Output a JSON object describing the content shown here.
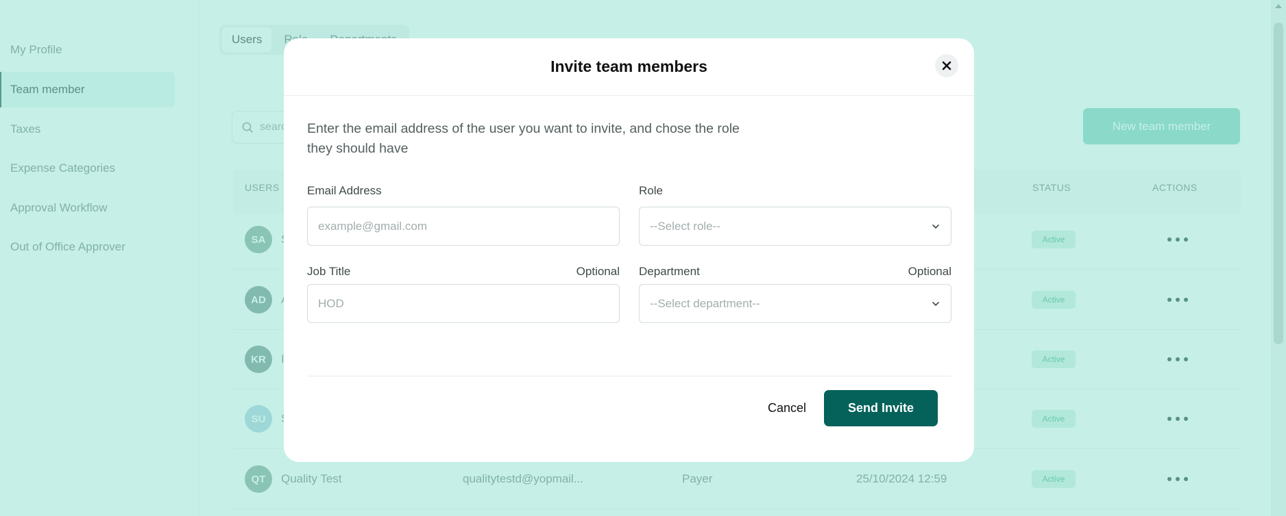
{
  "sidebar": {
    "items": [
      {
        "label": "My Profile"
      },
      {
        "label": "Team member"
      },
      {
        "label": "Taxes"
      },
      {
        "label": "Expense Categories"
      },
      {
        "label": "Approval Workflow"
      },
      {
        "label": "Out of Office Approver"
      }
    ]
  },
  "tabs": [
    {
      "label": "Users"
    },
    {
      "label": "Role"
    },
    {
      "label": "Departments"
    }
  ],
  "search": {
    "placeholder": "search"
  },
  "new_member_button": "New team member",
  "table": {
    "headers": {
      "users": "USERS",
      "status": "STATUS",
      "actions": "ACTIONS"
    },
    "rows": [
      {
        "initials": "SA",
        "name": "S",
        "email": "",
        "role": "",
        "date": "",
        "status": "Active",
        "avatar_color": "#8fae9f"
      },
      {
        "initials": "AD",
        "name": "A",
        "email": "",
        "role": "",
        "date": "",
        "status": "Active",
        "avatar_color": "#7f9c97"
      },
      {
        "initials": "KR",
        "name": "I",
        "email": "",
        "role": "",
        "date": "",
        "status": "Active",
        "avatar_color": "#7f9c97"
      },
      {
        "initials": "SU",
        "name": "S",
        "email": "",
        "role": "",
        "date": "",
        "status": "Active",
        "avatar_color": "#b3d2e0"
      },
      {
        "initials": "QT",
        "name": "Quality Test",
        "email": "qualitytestd@yopmail...",
        "role": "Payer",
        "date": "25/10/2024 12:59",
        "status": "Active",
        "avatar_color": "#8fae9f"
      }
    ]
  },
  "modal": {
    "title": "Invite team members",
    "description": "Enter the email address of the user you want to invite, and chose the role they should have",
    "email": {
      "label": "Email Address",
      "placeholder": "example@gmail.com",
      "value": ""
    },
    "role": {
      "label": "Role",
      "placeholder": "--Select role--"
    },
    "job_title": {
      "label": "Job Title",
      "optional": "Optional",
      "placeholder": "HOD",
      "value": ""
    },
    "department": {
      "label": "Department",
      "optional": "Optional",
      "placeholder": "--Select department--"
    },
    "cancel_label": "Cancel",
    "send_label": "Send Invite"
  },
  "colors": {
    "primary": "#04625a",
    "overlay": "#86ddcb",
    "badge_bg": "#d7f2e6",
    "badge_text": "#4fb88a"
  },
  "icons": {
    "search": "search-icon",
    "close": "close-icon",
    "chevron": "chevron-down-icon",
    "more": "more-horizontal-icon"
  }
}
